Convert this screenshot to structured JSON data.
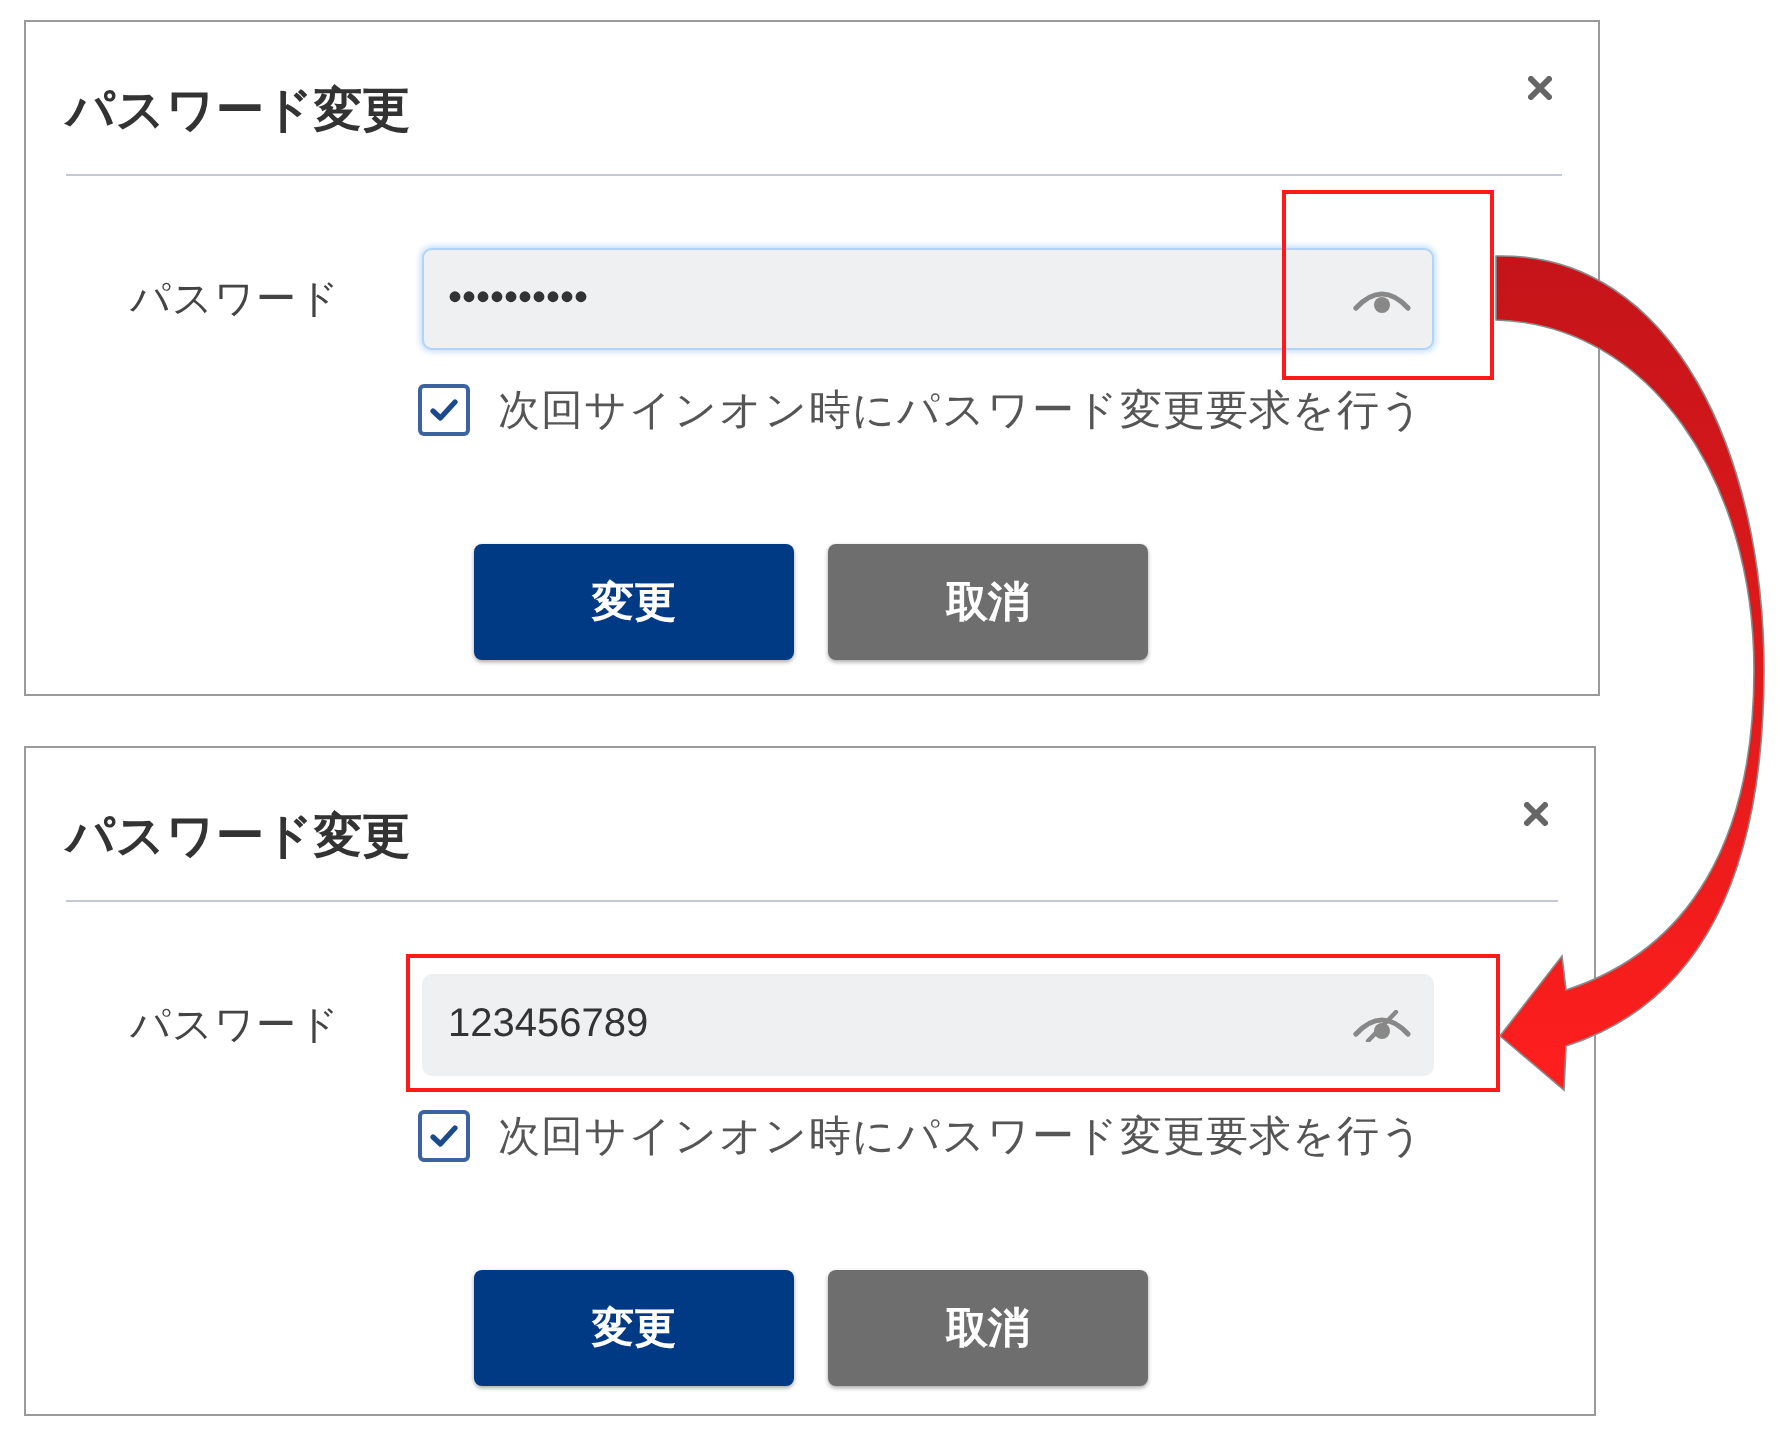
{
  "dialogs": [
    {
      "title": "パスワード変更",
      "password": {
        "label": "パスワード",
        "value": "••••••••••",
        "masked": true,
        "focused": true,
        "toggle_highlighted": true,
        "field_highlighted": false
      },
      "checkbox": {
        "label": "次回サインオン時にパスワード変更要求を行う",
        "checked": true
      },
      "buttons": [
        {
          "label": "変更",
          "kind": "primary"
        },
        {
          "label": "取消",
          "kind": "secondary"
        }
      ]
    },
    {
      "title": "パスワード変更",
      "password": {
        "label": "パスワード",
        "value": "123456789",
        "masked": false,
        "focused": false,
        "toggle_highlighted": false,
        "field_highlighted": true
      },
      "checkbox": {
        "label": "次回サインオン時にパスワード変更要求を行う",
        "checked": true
      },
      "buttons": [
        {
          "label": "変更",
          "kind": "primary"
        },
        {
          "label": "取消",
          "kind": "secondary"
        }
      ]
    }
  ]
}
